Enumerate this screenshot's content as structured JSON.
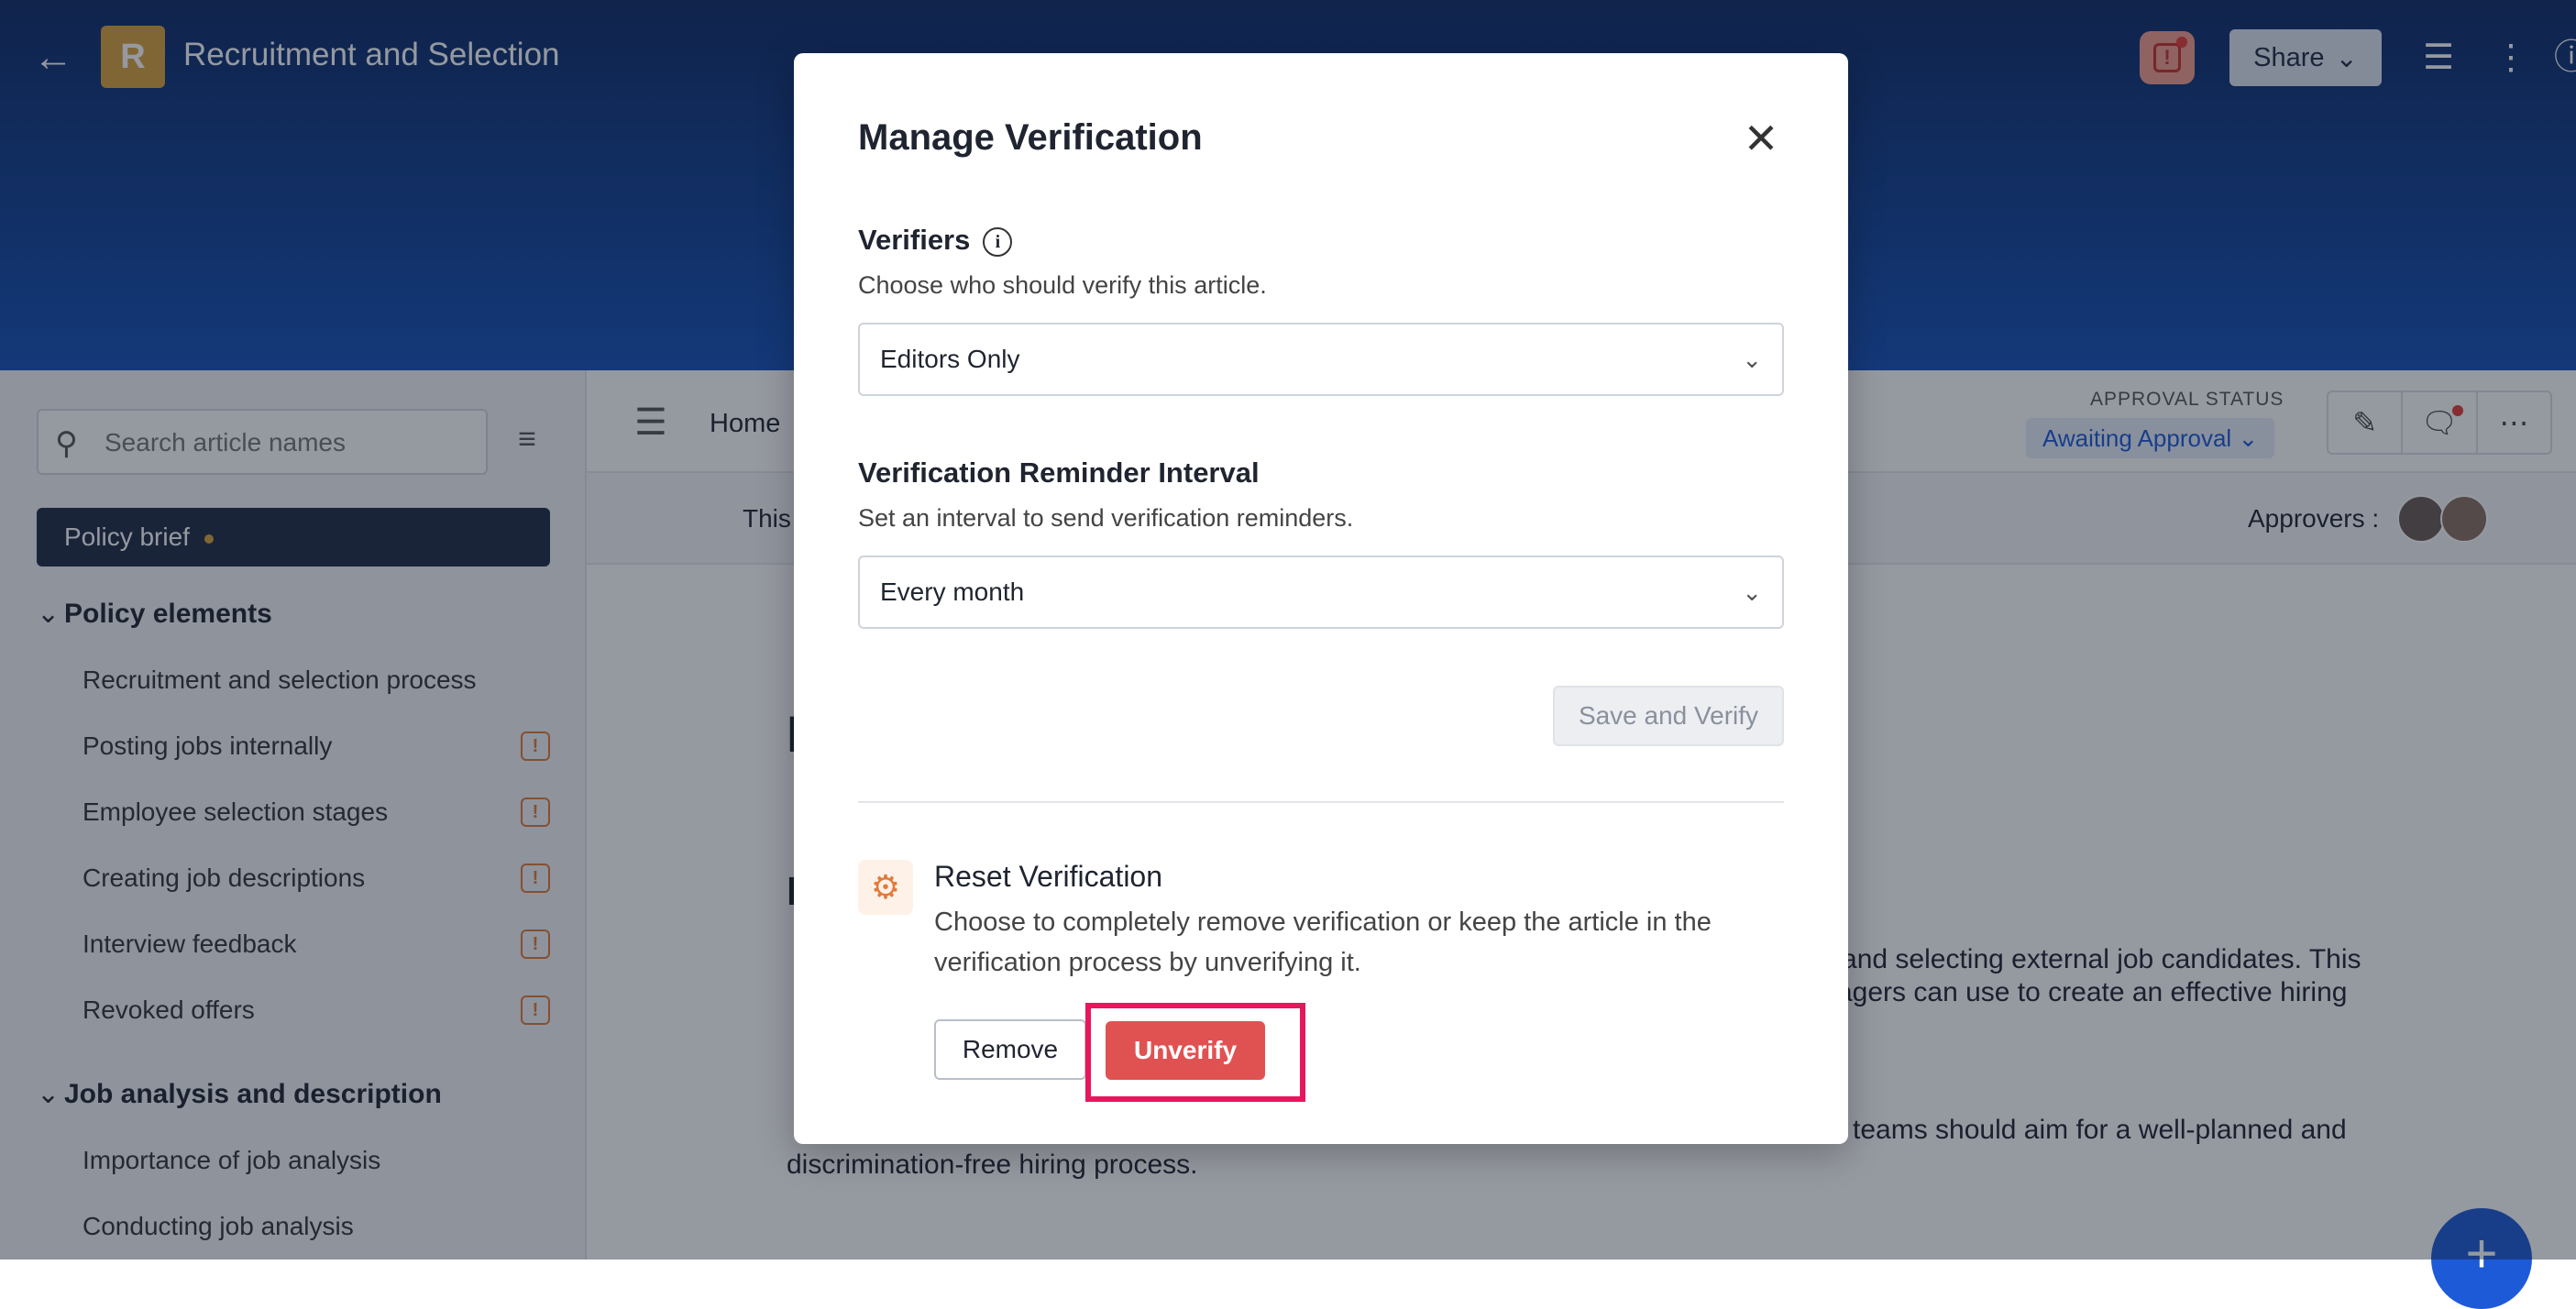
{
  "header": {
    "logo_letter": "R",
    "title": "Recruitment and Selection",
    "share_label": "Share",
    "back_icon": "arrow-left-icon",
    "notification_icon": "alert-icon",
    "settings_icon": "sliders-icon",
    "more_icon": "kebab-icon"
  },
  "sidebar": {
    "search_placeholder": "Search article names",
    "active_item": "Policy brief",
    "sections": [
      {
        "title": "Policy elements",
        "items": [
          {
            "label": "Recruitment and selection process",
            "warning": false
          },
          {
            "label": "Posting jobs internally",
            "warning": true
          },
          {
            "label": "Employee selection stages",
            "warning": true
          },
          {
            "label": "Creating job descriptions",
            "warning": true
          },
          {
            "label": "Interview feedback",
            "warning": true
          },
          {
            "label": "Revoked offers",
            "warning": true
          }
        ]
      },
      {
        "title": "Job analysis and description",
        "items": [
          {
            "label": "Importance of job analysis",
            "warning": false
          },
          {
            "label": "Conducting job analysis",
            "warning": false
          }
        ]
      }
    ],
    "warning_glyph": "!"
  },
  "main": {
    "breadcrumb_home": "Home",
    "approval_label": "APPROVAL STATUS",
    "approval_status": "Awaiting Approval",
    "banner_text": "This",
    "approvers_label": "Approvers :",
    "body_line_1": "g and selecting external job candidates. This",
    "body_line_2": "agers can use to create an effective hiring",
    "body_line_3": "teams should aim for a well-planned and",
    "body_line_4": "discrimination-free hiring process.",
    "fab_label": "+"
  },
  "modal": {
    "title": "Manage Verification",
    "close_glyph": "✕",
    "verifiers_label": "Verifiers",
    "verifiers_hint": "Choose who should verify this article.",
    "verifiers_value": "Editors Only",
    "interval_label": "Verification Reminder Interval",
    "interval_hint": "Set an interval to send verification reminders.",
    "interval_value": "Every month",
    "save_label": "Save and Verify",
    "reset_title": "Reset Verification",
    "reset_description": "Choose to completely remove verification or keep the article in the verification process by unverifying it.",
    "remove_label": "Remove",
    "unverify_label": "Unverify"
  },
  "colors": {
    "header_top": "#0d2a66",
    "header_bottom": "#1450b8",
    "unverify": "#e05252",
    "highlight": "#e8175d",
    "accent": "#1d5ad8"
  }
}
